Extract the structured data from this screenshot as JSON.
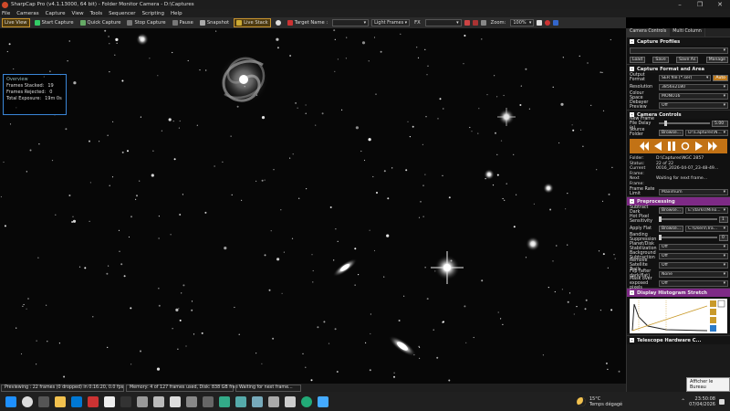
{
  "window": {
    "title": "SharpCap Pro (v4.1.13000, 64 bit) - Folder Monitor Camera - D:\\Captures"
  },
  "menu": [
    "File",
    "Cameras",
    "Capture",
    "View",
    "Tools",
    "Sequencer",
    "Scripting",
    "Help"
  ],
  "toolbar": {
    "live_view": "Live View",
    "start_capture": "Start Capture",
    "quick_capture": "Quick Capture",
    "stop_capture": "Stop Capture",
    "pause": "Pause",
    "snapshot": "Snapshot",
    "live_stack": "Live Stack",
    "target_name_label": "Target Name :",
    "target_name_value": "",
    "frame_type": "Light Frames",
    "fx_label": "FX",
    "fx_value": "",
    "zoom_label": "Zoom:",
    "zoom_value": "100%"
  },
  "overview": {
    "title": "Overview",
    "rows": [
      {
        "k": "Frames Stacked:",
        "v": "19"
      },
      {
        "k": "Frames Rejected:",
        "v": "0"
      },
      {
        "k": "Total Exposure:",
        "v": "19m 0s"
      }
    ]
  },
  "status": {
    "preview": "Previewing : 22 frames (0 dropped) in 0:16:20, 0.0 fps",
    "memory": "Memory: 4 of 127 frames used, Disk: 838 GB free",
    "waiting": "Waiting for next frame..."
  },
  "panel": {
    "tabs": [
      "Camera Controls",
      "Multi Column"
    ],
    "profiles": {
      "title": "Capture Profiles",
      "buttons": [
        "Load",
        "Save",
        "Save As",
        "Manage"
      ]
    },
    "format": {
      "title": "Capture Format and Area",
      "output_label": "Output Format",
      "output_value": "SER file (*.ser)",
      "auto": "Auto",
      "resolution_label": "Resolution",
      "resolution_value": "3856x2180",
      "colour_label": "Colour Space",
      "colour_value": "MONO16",
      "debayer_label": "Debayer Preview",
      "debayer_value": "Off"
    },
    "controls": {
      "title": "Camera Controls",
      "newframe_label": "New Frame File Delay (s)",
      "newframe_value": "5.00",
      "source_label": "Source Folder",
      "browse": "Browse...",
      "source_value": "D:\\Captures\\N..."
    },
    "folderinfo": [
      {
        "k": "Folder:",
        "v": "D:\\Captures\\NGC 2857"
      },
      {
        "k": "Status:",
        "v": "22 of 22"
      },
      {
        "k": "Current Frame:",
        "v": "0016_2026-04-07_23-48-49..."
      },
      {
        "k": "Next Frame:",
        "v": "Waiting for next frame..."
      }
    ],
    "framerate_label": "Frame Rate Limit",
    "framerate_value": "Maximum",
    "preprocessing": {
      "title": "Preprocessing",
      "rows": [
        {
          "k": "Subtract Dark",
          "b": "Browse...",
          "v": "E:\\darks\\Mino..."
        },
        {
          "k": "Hot Pixel Sensitivity",
          "v": "1"
        },
        {
          "k": "Apply Flat",
          "b": "Browse...",
          "v": "C:\\Users\\Tra..."
        },
        {
          "k": "Banding Suppression",
          "v": "0"
        },
        {
          "k": "Planet/Disk Stabilization",
          "v": "Off"
        },
        {
          "k": "Background Subtraction",
          "v": "Off"
        },
        {
          "k": "Remove Satellite Trails",
          "v": "Off"
        },
        {
          "k": "Flip (after dark/flat)",
          "v": "None"
        },
        {
          "k": "Mask over exposed pixels",
          "v": "Off"
        }
      ]
    },
    "histogram_title": "Display Histogram Stretch",
    "telescope_title": "Telescope Hardware C...",
    "colors": {
      "accent": "#c27215",
      "purple": "#7e2a86"
    }
  },
  "taskbar": {
    "weather_temp": "15°C",
    "weather_desc": "Temps dégagé",
    "time": "23:50:08",
    "date": "07/04/2026",
    "tooltip": "Afficher le Bureau"
  }
}
